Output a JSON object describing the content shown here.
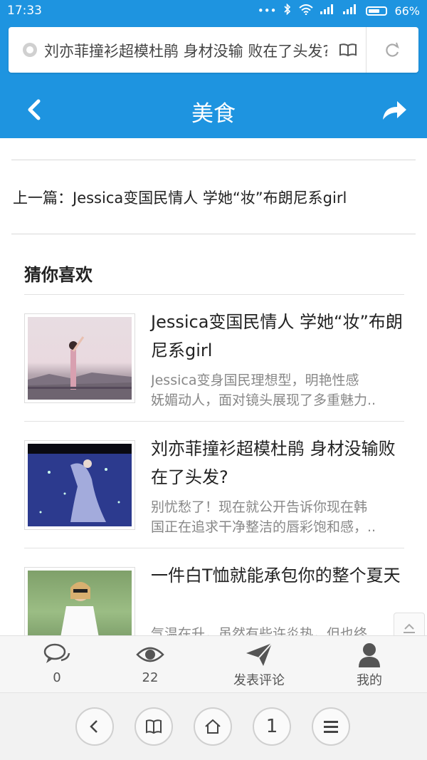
{
  "status_bar": {
    "time": "17:33",
    "battery": "66%",
    "battery_level": 0.66
  },
  "url_bar": {
    "text": "刘亦菲撞衫超模杜鹃 身材没输 败在了头发?"
  },
  "nav": {
    "title": "美食"
  },
  "prev_article": {
    "text": "上一篇：Jessica变国民情人 学她“妆”布朗尼系girl"
  },
  "recommend": {
    "title": "猜你喜欢",
    "items": [
      {
        "title": "Jessica变国民情人 学她“妆”布朗尼系girl",
        "desc_line1": "Jessica变身国民理想型，明艳性感",
        "desc_line2": "妩媚动人，面对镜头展现了多重魅力..",
        "thumb": "woman-on-road-photo"
      },
      {
        "title": "刘亦菲撞衫超模杜鹃 身材没输败在了头发?",
        "desc_line1": "别忧愁了！现在就公开告诉你现在韩",
        "desc_line2": "国正在追求干净整洁的唇彩饱和感，..",
        "thumb": "dancer-blue-stage-photo"
      },
      {
        "title": "一件白T恤就能承包你的整个夏天",
        "desc_line1": "气温在升，虽然有些许炎热，但也终",
        "desc_line2": "",
        "thumb": "woman-white-tshirt-photo"
      }
    ]
  },
  "bottom_bar": {
    "comments_count": "0",
    "views_count": "22",
    "post_comment": "发表评论",
    "mine": "我的"
  },
  "browser_bar": {
    "tab_count": "1"
  },
  "colors": {
    "brand_blue": "#1e94e0"
  }
}
